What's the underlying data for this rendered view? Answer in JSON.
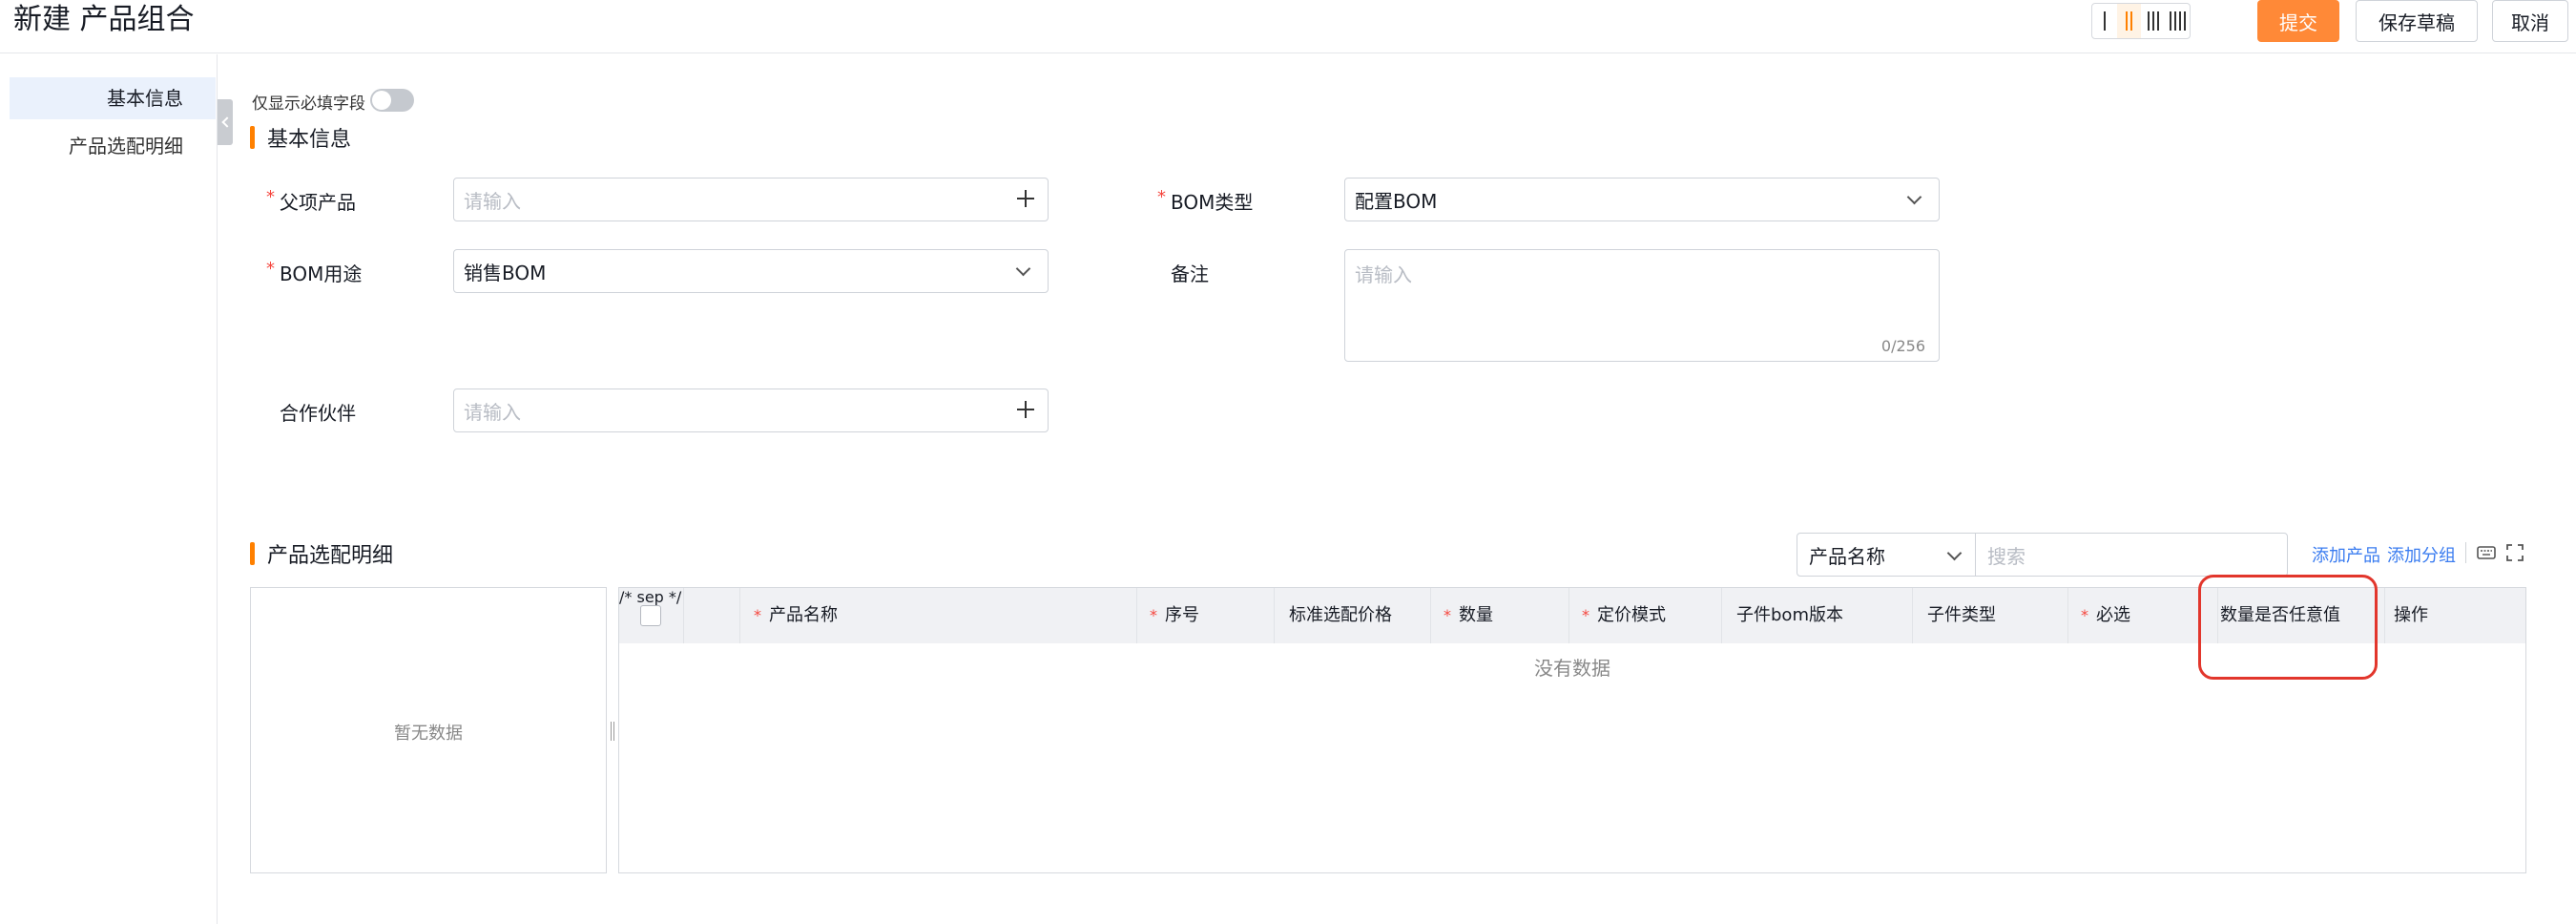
{
  "header": {
    "title": "新建 产品组合",
    "submit_label": "提交",
    "save_draft_label": "保存草稿",
    "cancel_label": "取消",
    "column_layout_options": [
      1,
      2,
      3,
      4
    ],
    "column_layout_selected": 2
  },
  "nav": {
    "items": [
      {
        "label": "基本信息",
        "active": true
      },
      {
        "label": "产品选配明细",
        "active": false
      }
    ]
  },
  "form": {
    "required_only_label": "仅显示必填字段",
    "required_only_on": false,
    "section_title": "基本信息",
    "parent_product": {
      "label": "父项产品",
      "placeholder": "请输入",
      "required": true
    },
    "bom_type": {
      "label": "BOM类型",
      "value": "配置BOM",
      "required": true
    },
    "bom_usage": {
      "label": "BOM用途",
      "value": "销售BOM",
      "required": true
    },
    "remark": {
      "label": "备注",
      "placeholder": "请输入",
      "counter": "0/256",
      "required": false
    },
    "partner": {
      "label": "合作伙伴",
      "placeholder": "请输入",
      "required": false
    }
  },
  "detail": {
    "section_title": "产品选配明细",
    "filter_field": "产品名称",
    "search_placeholder": "搜索",
    "add_product_label": "添加产品",
    "add_group_label": "添加分组",
    "tree_empty": "暂无数据",
    "grid_empty": "没有数据",
    "columns": [
      {
        "label": "产品名称",
        "required": true
      },
      {
        "label": "序号",
        "required": true
      },
      {
        "label": "标准选配价格",
        "required": false
      },
      {
        "label": "数量",
        "required": true
      },
      {
        "label": "定价模式",
        "required": true
      },
      {
        "label": "子件bom版本",
        "required": false
      },
      {
        "label": "子件类型",
        "required": false
      },
      {
        "label": "必选",
        "required": true
      },
      {
        "label": "数量是否任意值",
        "required": false
      },
      {
        "label": "操作",
        "required": false
      }
    ]
  },
  "colors": {
    "accent": "#ff8937",
    "link": "#3a7cf0",
    "required_star": "#f5453d",
    "highlight_box": "#e2362c"
  }
}
